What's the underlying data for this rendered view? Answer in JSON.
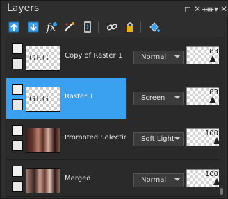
{
  "window": {
    "title": "Layers",
    "controls": [
      "restore",
      "close-x",
      "pin",
      "more",
      "close"
    ]
  },
  "toolbar": {
    "icons": [
      "new-raster-layer-icon",
      "new-mask-layer-icon",
      "new-adjustment-layer-icon",
      "effects-layer-icon",
      "vector-layer-icon",
      "link-icon",
      "lock-icon",
      "fill-icon"
    ]
  },
  "layers": [
    {
      "name": "Copy of Raster 1",
      "blend_mode": "Normal",
      "opacity": "83",
      "opacity_fraction": 0.83,
      "selected": false,
      "thumb_text": "GEG"
    },
    {
      "name": "Raster 1",
      "blend_mode": "Screen",
      "opacity": "83",
      "opacity_fraction": 0.83,
      "selected": true,
      "thumb_text": "GEG"
    },
    {
      "name": "Promoted Selection",
      "blend_mode": "Soft Light",
      "opacity": "100",
      "opacity_fraction": 1.0,
      "selected": false,
      "thumb_text": ""
    },
    {
      "name": "Merged",
      "blend_mode": "Normal",
      "opacity": "100",
      "opacity_fraction": 1.0,
      "selected": false,
      "thumb_text": ""
    }
  ],
  "colors": {
    "selection": "#3aa0f0",
    "panel_bg": "#2e2e2e",
    "list_bg": "#2a2a2a"
  }
}
